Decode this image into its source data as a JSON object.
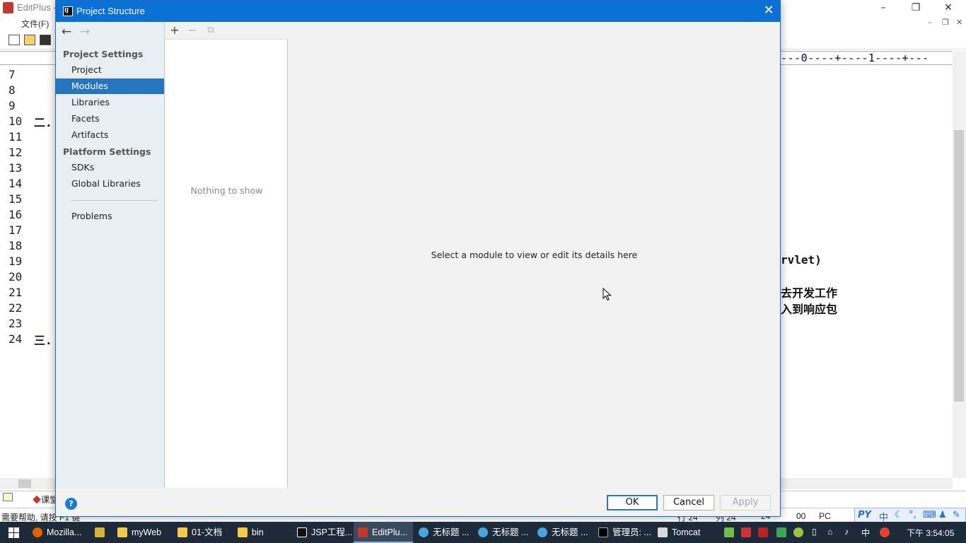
{
  "editplus": {
    "app_title": "EditPlus -",
    "menu_file": "文件(F)",
    "ruler_text": "---0----+----1----+---",
    "line_numbers": [
      "7",
      "8",
      "9",
      "10",
      "11",
      "12",
      "13",
      "14",
      "15",
      "16",
      "17",
      "18",
      "19",
      "20",
      "21",
      "22",
      "23",
      "24"
    ],
    "code_line10_prefix": "二.",
    "code_line24_prefix": "三.",
    "code_fragment_1": "rvlet)",
    "code_fragment_2": "去开发工作",
    "code_fragment_3": "入到响应包",
    "file_tab": "课堂",
    "status_help": "需要帮助, 请按 F1 键",
    "status_row": "行 24",
    "status_col": "列 24",
    "status_num": "24",
    "status_00": "00",
    "status_pc": "PC"
  },
  "dialog": {
    "title": "Project Structure",
    "nav": {
      "project_settings": "Project Settings",
      "platform_settings": "Platform Settings",
      "items": {
        "project": "Project",
        "modules": "Modules",
        "libraries": "Libraries",
        "facets": "Facets",
        "artifacts": "Artifacts",
        "sdks": "SDKs",
        "global_libraries": "Global Libraries",
        "problems": "Problems"
      },
      "selected": "Modules"
    },
    "list": {
      "add": "+",
      "remove": "−",
      "copy": "⧉",
      "empty_text": "Nothing to show"
    },
    "detail_text": "Select a module to view or edit its details here",
    "buttons": {
      "ok": "OK",
      "cancel": "Cancel",
      "apply": "Apply",
      "help": "?"
    }
  },
  "taskbar": {
    "items": [
      "Mozilla...",
      "myWeb",
      "01-文档",
      "bin",
      "JSP工程...",
      "EditPlu...",
      "无标题 ...",
      "无标题 ...",
      "无标题 ...",
      "管理员: ...",
      "Tomcat"
    ],
    "ime": "中",
    "clock": "下午 3:54:05"
  },
  "colors": {
    "dialog_title_bar": "#0c71d6",
    "nav_selected": "#2675bf",
    "taskbar": "#1c2a3a"
  }
}
